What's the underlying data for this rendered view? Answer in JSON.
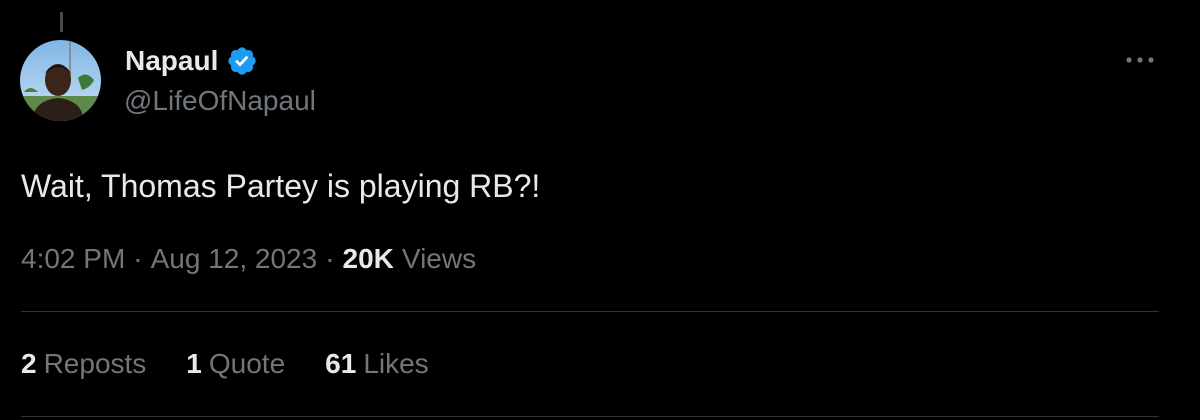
{
  "account": {
    "display_name": "Napaul",
    "handle": "@LifeOfNapaul",
    "verified_icon": "verified-badge-icon",
    "avatar_icon": "profile-photo"
  },
  "more_icon": "more-options-icon",
  "tweet": {
    "text": "Wait, Thomas Partey is playing RB?!",
    "time": "4:02 PM",
    "separator": "·",
    "date": "Aug 12, 2023",
    "views_count": "20K",
    "views_label": "Views"
  },
  "stats": {
    "reposts_count": "2",
    "reposts_label": "Reposts",
    "quotes_count": "1",
    "quotes_label": "Quote",
    "likes_count": "61",
    "likes_label": "Likes"
  },
  "colors": {
    "background": "#000000",
    "primary_text": "#e7e9ea",
    "secondary_text": "#71767b",
    "verified_blue": "#1d9bf0",
    "divider": "#2f3336"
  }
}
